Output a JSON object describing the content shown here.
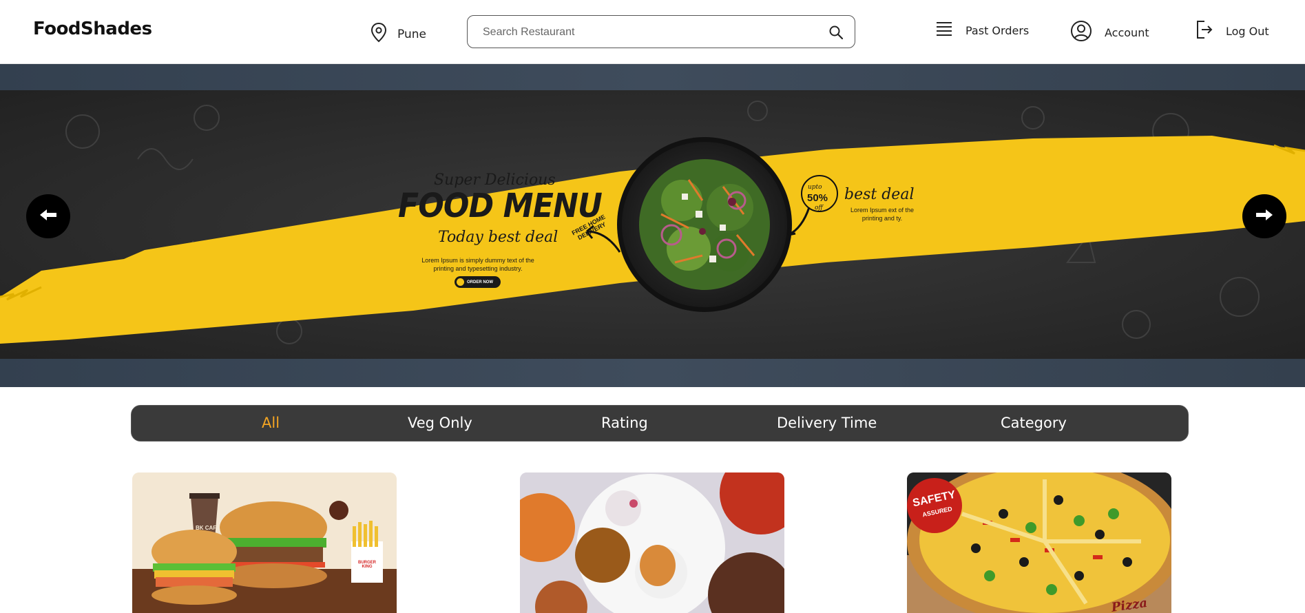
{
  "app": {
    "name": "FoodShades"
  },
  "header": {
    "location": "Pune",
    "search_placeholder": "Search Restaurant",
    "past_orders": "Past Orders",
    "account": "Account",
    "logout": "Log Out"
  },
  "banner": {
    "subtitle": "Super Delicious",
    "title": "FOOD MENU",
    "tagline": "Today best deal",
    "body": "Lorem Ipsum is simply dummy text of the printing and typesetting industry.",
    "cta": "ORDER NOW",
    "free_delivery": "FREE HOME DELIVERY",
    "upto": "upto",
    "discount": "50%",
    "off": "off",
    "deal": "best deal",
    "deal_text": "Lorem Ipsum ext of the printing and ty."
  },
  "filters": [
    {
      "label": "All",
      "active": true
    },
    {
      "label": "Veg Only",
      "active": false
    },
    {
      "label": "Rating",
      "active": false
    },
    {
      "label": "Delivery Time",
      "active": false
    },
    {
      "label": "Category",
      "active": false
    }
  ],
  "cards": [
    {
      "name": "burger-king-card",
      "label_cafe": "BK CAFÉ",
      "label_brand": "BURGER KING"
    },
    {
      "name": "indian-thali-card"
    },
    {
      "name": "pizza-hut-card",
      "badge_top": "SAFETY",
      "badge_bottom": "ASSURED",
      "brand": "Pizza Hut"
    }
  ],
  "colors": {
    "accent": "#f5a623",
    "banner_yellow": "#f5c518",
    "filter_bg": "#3a3a3a",
    "banner_bg": "#3b4756"
  }
}
